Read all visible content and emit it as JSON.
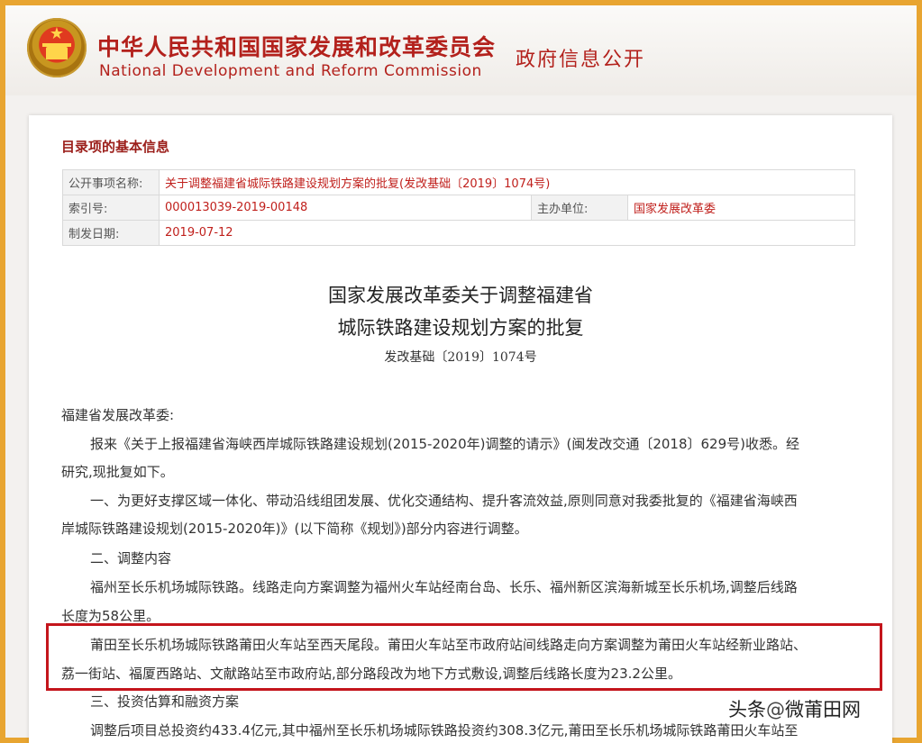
{
  "header": {
    "org_cn": "中华人民共和国国家发展和改革委员会",
    "org_en": "National Development and Reform Commission",
    "section": "政府信息公开",
    "emblem_icon": "national-emblem-icon"
  },
  "info": {
    "title": "目录项的基本信息",
    "rows": [
      {
        "label": "公开事项名称:",
        "value": "关于调整福建省城际铁路建设规划方案的批复(发改基础〔2019〕1074号)"
      },
      {
        "label": "索引号:",
        "value": "000013039-2019-00148",
        "label2": "主办单位:",
        "value2": "国家发展改革委"
      },
      {
        "label": "制发日期:",
        "value": "2019-07-12"
      }
    ]
  },
  "doc": {
    "title_line1": "国家发展改革委关于调整福建省",
    "title_line2": "城际铁路建设规划方案的批复",
    "doc_no": "发改基础〔2019〕1074号",
    "addressee": "福建省发展改革委:",
    "paragraphs": [
      "报来《关于上报福建省海峡西岸城际铁路建设规划(2015-2020年)调整的请示》(闽发改交通〔2018〕629号)收悉。经",
      "研究,现批复如下。",
      "一、为更好支撑区域一体化、带动沿线组团发展、优化交通结构、提升客流效益,原则同意对我委批复的《福建省海峡西",
      "岸城际铁路建设规划(2015-2020年)》(以下简称《规划》)部分内容进行调整。",
      "二、调整内容",
      "福州至长乐机场城际铁路。线路走向方案调整为福州火车站经南台岛、长乐、福州新区滨海新城至长乐机场,调整后线路",
      "长度为58公里。",
      "莆田至长乐机场城际铁路莆田火车站至西天尾段。莆田火车站至市政府站间线路走向方案调整为莆田火车站经新业路站、",
      "荔一街站、福厦西路站、文献路站至市政府站,部分路段改为地下方式敷设,调整后线路长度为23.2公里。",
      "三、投资估算和融资方案",
      "调整后项目总投资约433.4亿元,其中福州至长乐机场城际铁路投资约308.3亿元,莆田至长乐机场城际铁路莆田火车站至"
    ]
  },
  "watermark": {
    "prefix": "头条",
    "at": "@",
    "account": "微莆田网"
  },
  "colors": {
    "brand_red": "#b3211c",
    "frame_orange": "#e8a531",
    "highlight_red": "#c4151c"
  }
}
